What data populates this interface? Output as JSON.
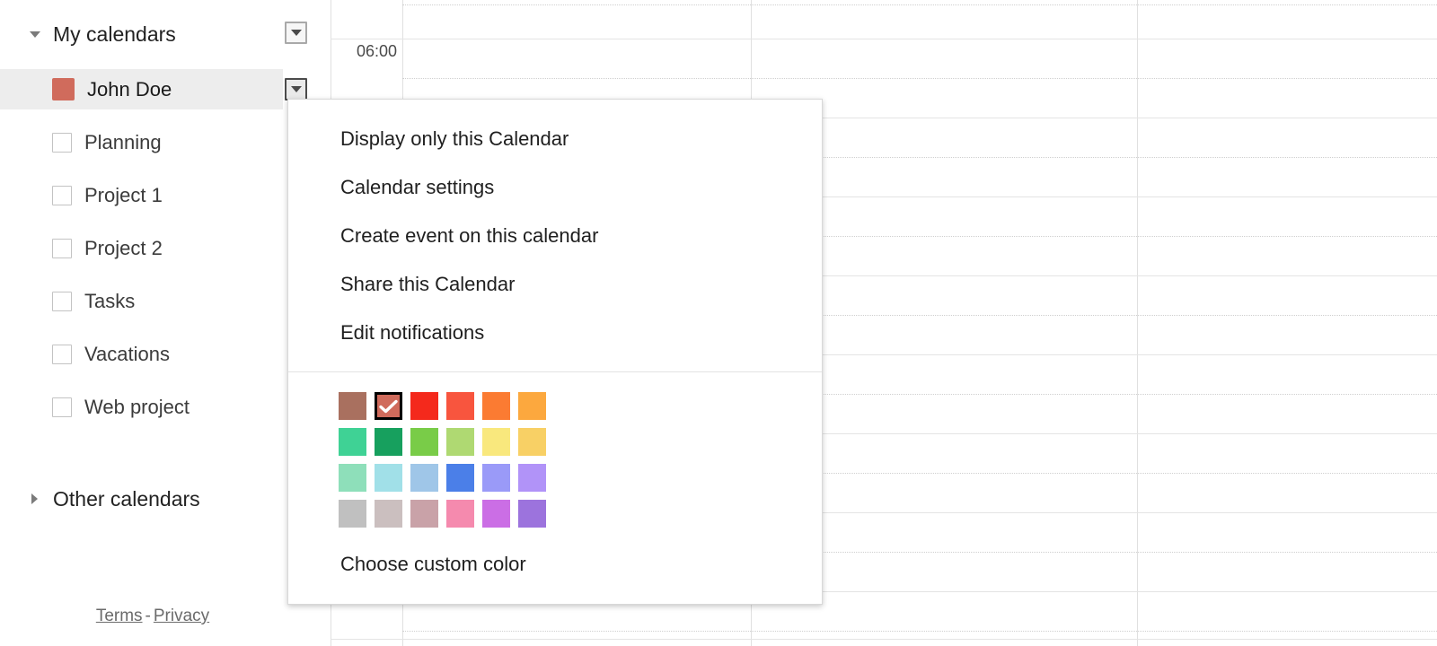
{
  "sidebar": {
    "my_calendars": {
      "title": "My calendars",
      "expanded": true,
      "options_icon": "chevron-down-icon"
    },
    "other_calendars": {
      "title": "Other calendars",
      "expanded": false
    },
    "calendars": [
      {
        "label": "John Doe",
        "type": "swatch",
        "color": "#D06B5C",
        "selected": true,
        "has_menu": true
      },
      {
        "label": "Planning",
        "type": "checkbox",
        "checked": false
      },
      {
        "label": "Project 1",
        "type": "checkbox",
        "checked": false
      },
      {
        "label": "Project 2",
        "type": "checkbox",
        "checked": false
      },
      {
        "label": "Tasks",
        "type": "checkbox",
        "checked": false
      },
      {
        "label": "Vacations",
        "type": "checkbox",
        "checked": false
      },
      {
        "label": "Web project",
        "type": "checkbox",
        "checked": false
      }
    ],
    "footer": {
      "terms": "Terms",
      "separator": "-",
      "privacy": "Privacy"
    }
  },
  "context_menu": {
    "items": [
      "Display only this Calendar",
      "Calendar settings",
      "Create event on this calendar",
      "Share this Calendar",
      "Edit notifications"
    ],
    "custom_color_label": "Choose custom color",
    "selected_color": "#D06B5C",
    "color_rows": [
      [
        "#A9705F",
        "#D06B5C",
        "#F4291C",
        "#F8553E",
        "#FB7B32",
        "#FCA83E"
      ],
      [
        "#3FD295",
        "#17A05E",
        "#79CC48",
        "#AFD972",
        "#F9E87D",
        "#F8D065"
      ],
      [
        "#8EDFBA",
        "#A1E0E8",
        "#9FC6E8",
        "#4B7FE8",
        "#9A9AF8",
        "#B193F8"
      ],
      [
        "#C0C0C0",
        "#CBBFBF",
        "#C9A2A8",
        "#F58AAE",
        "#CB6EE5",
        "#9C73DD"
      ]
    ]
  },
  "calendar_grid": {
    "time_labels": [
      "06:00"
    ],
    "grid_line_color": "#e0e0e0",
    "half_hour_line_color": "#cfcfcf"
  }
}
